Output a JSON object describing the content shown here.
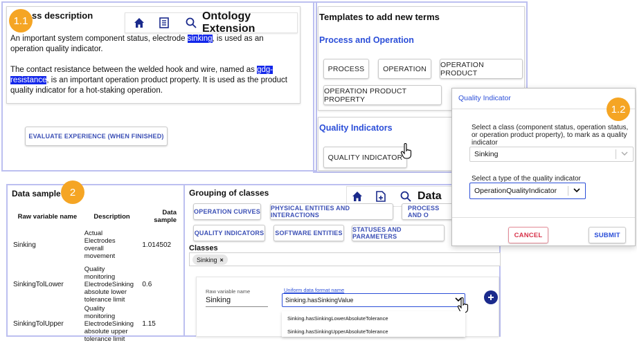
{
  "badges": {
    "b11": "1.1",
    "b12": "1.2",
    "b2": "2"
  },
  "process_description": {
    "title_fragment": "ss description",
    "p1_a": "An important system component status, electrode ",
    "p1_hl": "sinking",
    "p1_b": ", is used as an operation quality indicator.",
    "p2_a": "The contact resistance between the welded hook and wire, named as ",
    "p2_hl1": "gdg-",
    "p2_hl2": "resistance",
    "p2_b": ", is an important operation product property. It is used as the product quality indicator for a hot-staking operation."
  },
  "ontology_toolbar": {
    "title": "Ontology Extension"
  },
  "evaluate_button": "EVALUATE EXPERIENCE (WHEN FINISHED)",
  "templates": {
    "title": "Templates to add new terms",
    "process_section": "Process and Operation",
    "buttons": [
      "PROCESS",
      "OPERATION",
      "OPERATION PRODUCT",
      "OPERATION PRODUCT PROPERTY"
    ],
    "quality_section": "Quality Indicators",
    "quality_button": "QUALITY INDICATOR"
  },
  "dialog": {
    "title": "Quality Indicator",
    "class_label": "Select a class (component status, operation status, or operation product property), to mark as a quality indicator",
    "class_value": "Sinking",
    "type_label": "Select a type of the quality indicator",
    "type_value": "OperationQualityIndicator",
    "cancel": "CANCEL",
    "submit": "SUBMIT"
  },
  "data_sample": {
    "title": "Data sample",
    "headers": [
      "Raw variable name",
      "Description",
      "Data sample"
    ],
    "rows": [
      {
        "name": "Sinking",
        "desc": [
          "Actual",
          "Electrodes",
          "overall",
          "movement"
        ],
        "value": "1.014502"
      },
      {
        "name": "SinkingTolLower",
        "desc": [
          "Quality",
          "monitoring",
          "ElectrodeSinking",
          "absolute lower",
          "tolerance limit"
        ],
        "value": "0.6"
      },
      {
        "name": "SinkingTolUpper",
        "desc": [
          "Quality",
          "monitoring",
          "ElectrodeSinking",
          "absolute upper",
          "tolerance limit"
        ],
        "value": "1.15"
      }
    ]
  },
  "grouping": {
    "title": "Grouping of classes",
    "toolbar_title": "Data",
    "groups": [
      "OPERATION CURVES",
      "PHYSICAL ENTITIES AND INTERACTIONS",
      "PROCESS AND O",
      "QUALITY INDICATORS",
      "SOFTWARE ENTITIES",
      "STATUSES AND PARAMETERS"
    ],
    "classes_label": "Classes",
    "class_chip": "Sinking",
    "raw_label": "Raw variable name",
    "raw_value": "Sinking",
    "uniform_label": "Uniform data format name",
    "uniform_value": "Sinking.hasSinkingValue",
    "options": [
      "Sinking.hasSinkingLowerAbsoluteTolerance",
      "Sinking.hasSinkingUpperAbsoluteTolerance"
    ]
  },
  "colors": {
    "accent": "#1a2a8c",
    "highlight": "#1226ea",
    "badge": "#f5a524",
    "section": "#2b4ed8",
    "cancel": "#d8334a"
  }
}
